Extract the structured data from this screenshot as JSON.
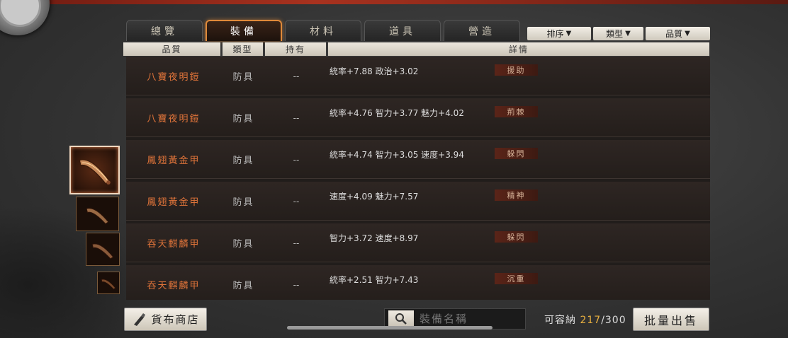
{
  "tabs": [
    {
      "label": "總覽"
    },
    {
      "label": "裝備"
    },
    {
      "label": "材料"
    },
    {
      "label": "道具"
    },
    {
      "label": "營造"
    }
  ],
  "filters": {
    "sort": "排序",
    "type": "類型",
    "quality": "品質"
  },
  "columns": {
    "quality": "品質",
    "type": "類型",
    "own": "持有",
    "detail": "詳情"
  },
  "items": [
    {
      "name": "八寶夜明鎧",
      "type": "防具",
      "own": "--",
      "detail": "統率+7.88 政治+3.02",
      "tag": "援助"
    },
    {
      "name": "八寶夜明鎧",
      "type": "防具",
      "own": "--",
      "detail": "統率+4.76 智力+3.77 魅力+4.02",
      "tag": "荊棘"
    },
    {
      "name": "鳳翅黃金甲",
      "type": "防具",
      "own": "--",
      "detail": "統率+4.74 智力+3.05 速度+3.94",
      "tag": "躲閃"
    },
    {
      "name": "鳳翅黃金甲",
      "type": "防具",
      "own": "--",
      "detail": "速度+4.09 魅力+7.57",
      "tag": "精神"
    },
    {
      "name": "吞天麒麟甲",
      "type": "防具",
      "own": "--",
      "detail": "智力+3.72 速度+8.97",
      "tag": "躲閃"
    },
    {
      "name": "吞天麒麟甲",
      "type": "防具",
      "own": "--",
      "detail": "統率+2.51 智力+7.43",
      "tag": "沉重"
    }
  ],
  "footer": {
    "shop_label": "貨布商店",
    "search_placeholder": "裝備名稱",
    "capacity_label": "可容納",
    "capacity_count": "217",
    "capacity_max": "/300",
    "sell_label": "批量出售"
  },
  "colors": {
    "accent": "#e08a3a",
    "item_name": "#e0743a",
    "capacity_count": "#e8b040"
  },
  "icons": [
    "search-icon",
    "shop-icon",
    "sort-arrow-icon"
  ]
}
